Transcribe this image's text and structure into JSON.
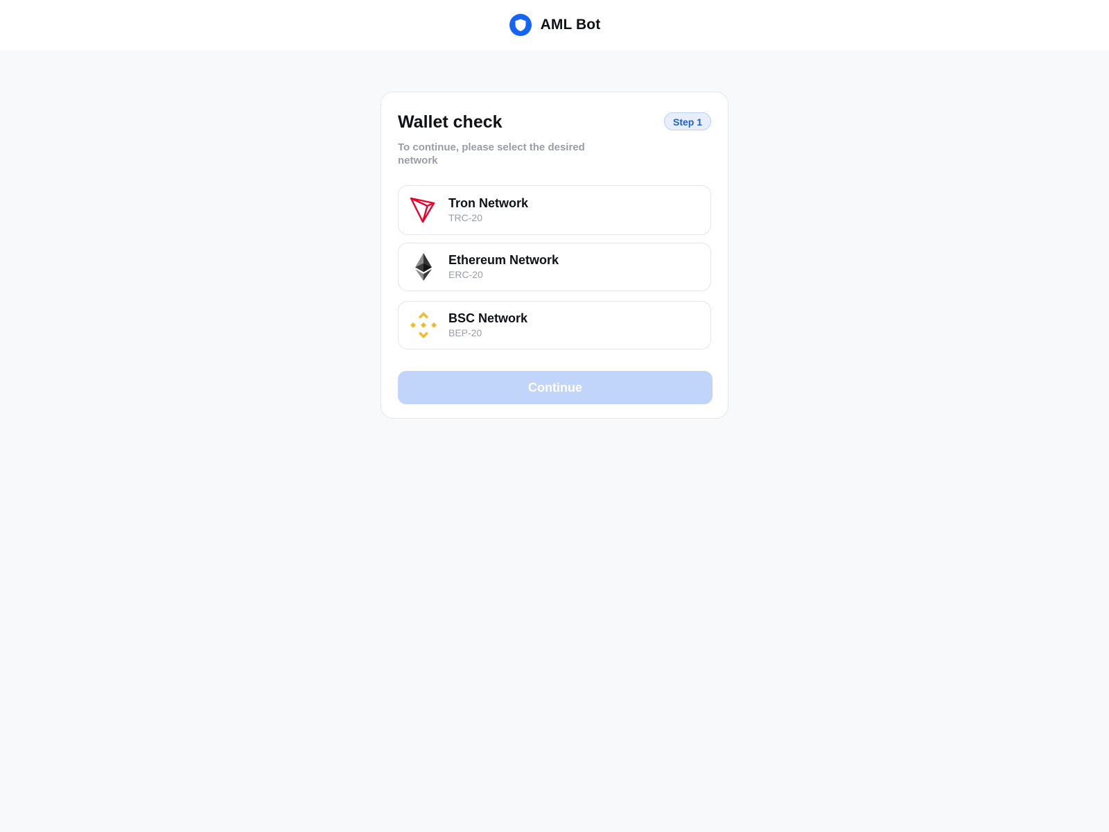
{
  "header": {
    "brand_name": "AML Bot",
    "logo_icon": "shield-icon",
    "logo_color": "#1565f5"
  },
  "card": {
    "title": "Wallet check",
    "step_label": "Step 1",
    "subtitle": "To continue, please select the desired network",
    "networks": [
      {
        "name": "Tron Network",
        "standard": "TRC-20",
        "icon": "tron-icon",
        "color": "#eb0029"
      },
      {
        "name": "Ethereum Network",
        "standard": "ERC-20",
        "icon": "ethereum-icon",
        "color": "#343434"
      },
      {
        "name": "BSC Network",
        "standard": "BEP-20",
        "icon": "binance-icon",
        "color": "#f3ba2f"
      }
    ],
    "continue_label": "Continue",
    "continue_disabled_color": "#c1d5fb"
  }
}
